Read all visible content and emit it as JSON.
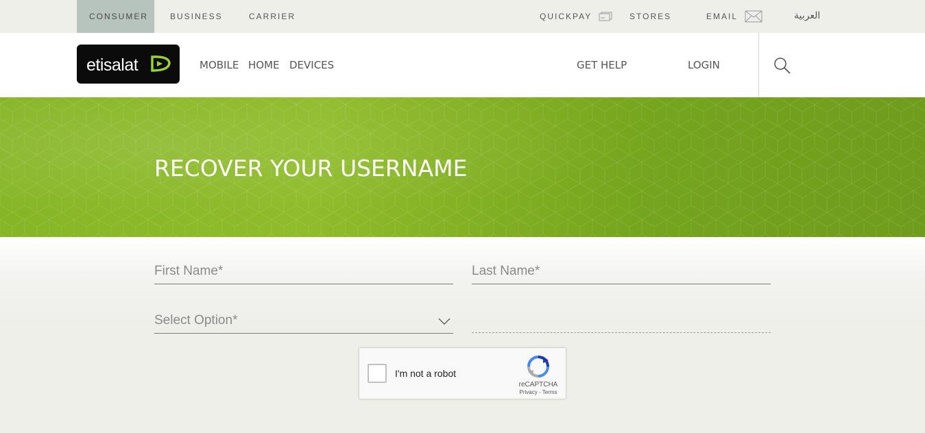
{
  "topbar": {
    "segments": [
      {
        "label": "CONSUMER",
        "active": true
      },
      {
        "label": "BUSINESS",
        "active": false
      },
      {
        "label": "CARRIER",
        "active": false
      }
    ],
    "utilities": [
      {
        "label": "QUICKPAY",
        "icon": "card-icon"
      },
      {
        "label": "STORES"
      },
      {
        "label": "EMAIL",
        "icon": "envelope-icon"
      }
    ],
    "language": "العربية"
  },
  "header": {
    "logo_text": "etisalat",
    "nav": [
      "MOBILE",
      "HOME",
      "DEVICES"
    ],
    "get_help": "GET HELP",
    "login": "LOGIN",
    "search_icon": "search-icon"
  },
  "hero": {
    "title": "RECOVER YOUR USERNAME"
  },
  "form": {
    "first_name_placeholder": "First Name*",
    "last_name_placeholder": "Last Name*",
    "select_placeholder": "Select Option*"
  },
  "captcha": {
    "label": "I'm not a robot",
    "brand": "reCAPTCHA",
    "links": "Privacy - Terms"
  },
  "colors": {
    "brand_green": "#8ab82a",
    "active_segment": "#b7c3bd",
    "page_bg": "#efefea"
  }
}
